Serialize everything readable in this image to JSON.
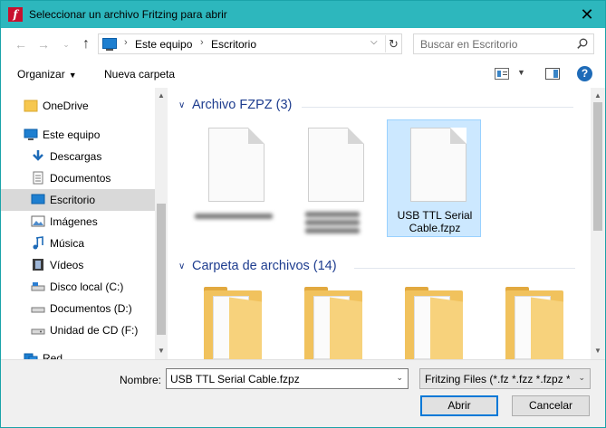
{
  "titlebar": {
    "title": "Seleccionar un archivo Fritzing para abrir",
    "app_icon_letter": "f",
    "close_glyph": "✕"
  },
  "address": {
    "crumbs": [
      "Este equipo",
      "Escritorio"
    ],
    "separator": "›"
  },
  "search": {
    "placeholder": "Buscar en Escritorio"
  },
  "toolbar": {
    "organize_label": "Organizar",
    "new_folder_label": "Nueva carpeta",
    "help_label": "?"
  },
  "sidebar": {
    "items": [
      {
        "label": "OneDrive",
        "icon": "folder-icon"
      },
      {
        "label": "Este equipo",
        "icon": "computer-icon"
      },
      {
        "label": "Descargas",
        "icon": "download-icon"
      },
      {
        "label": "Documentos",
        "icon": "document-icon"
      },
      {
        "label": "Escritorio",
        "icon": "desktop-icon",
        "selected": true
      },
      {
        "label": "Imágenes",
        "icon": "pictures-icon"
      },
      {
        "label": "Música",
        "icon": "music-icon"
      },
      {
        "label": "Vídeos",
        "icon": "videos-icon"
      },
      {
        "label": "Disco local (C:)",
        "icon": "drive-icon"
      },
      {
        "label": "Documentos (D:)",
        "icon": "drive-icon"
      },
      {
        "label": "Unidad de CD (F:)",
        "icon": "cd-drive-icon"
      },
      {
        "label": "Red",
        "icon": "network-icon"
      }
    ]
  },
  "groups": [
    {
      "title": "Archivo FZPZ (3)"
    },
    {
      "title": "Carpeta de archivos (14)"
    }
  ],
  "files": [
    {
      "name": "USB TTL Serial Cable.fzpz",
      "selected": true
    }
  ],
  "footer": {
    "filename_label": "Nombre:",
    "filename_value": "USB TTL Serial Cable.fzpz",
    "filetype_value": "Fritzing Files (*.fz *.fzz *.fzpz *.fzb",
    "open_label": "Abrir",
    "cancel_label": "Cancelar"
  },
  "colors": {
    "titlebar": "#2db7bd",
    "selection": "#cce8ff",
    "group_title": "#1e3d8f",
    "accent": "#0078d7"
  }
}
